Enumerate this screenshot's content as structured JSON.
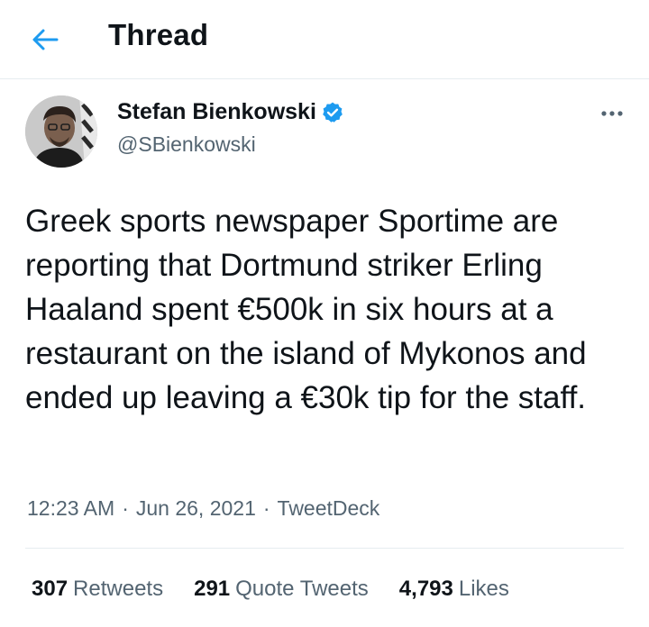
{
  "header": {
    "title": "Thread",
    "back_icon": "arrow-left-icon"
  },
  "colors": {
    "accent": "#1d9bf0",
    "text_primary": "#0f1419",
    "text_secondary": "#536471",
    "divider": "#e6ecf0"
  },
  "tweet": {
    "author": {
      "display_name": "Stefan Bienkowski",
      "handle": "@SBienkowski",
      "verified": true,
      "avatar_icon": "avatar"
    },
    "more_icon": "more-horizontal-icon",
    "text": "Greek sports newspaper Sportime are reporting that Dortmund striker Erling Haaland spent €500k in six hours at a restaurant on the island of Mykonos and ended up leaving a €30k tip for the staff.",
    "time": "12:23 AM",
    "separator": "·",
    "date": "Jun 26, 2021",
    "source": "TweetDeck"
  },
  "stats": {
    "retweets_count": "307",
    "retweets_label": "Retweets",
    "quotes_count": "291",
    "quotes_label": "Quote Tweets",
    "likes_count": "4,793",
    "likes_label": "Likes"
  }
}
